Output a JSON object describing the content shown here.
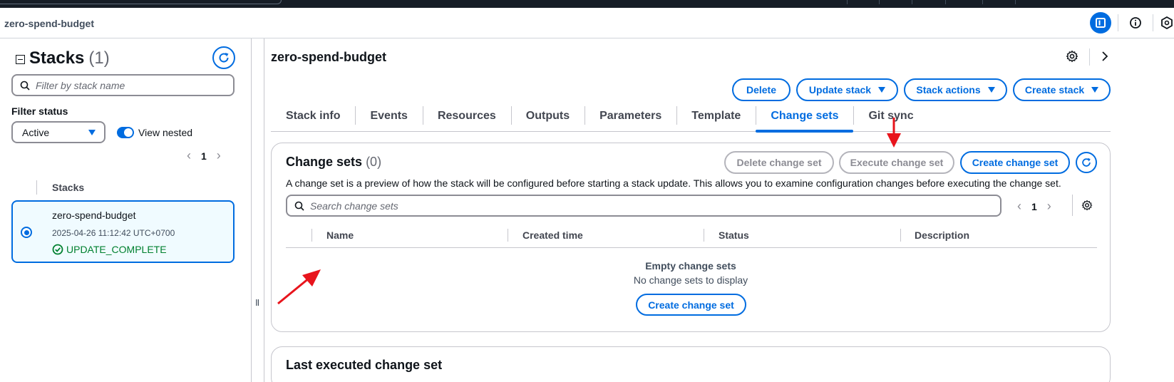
{
  "app": {
    "breadcrumb": "zero-spend-budget"
  },
  "colors": {
    "accent": "#006ce0",
    "success": "#00802f",
    "annotation_arrow": "#e8141c"
  },
  "topbar_icons": [
    "split-panel-icon",
    "info-icon",
    "settings-hex-icon"
  ],
  "sidebar": {
    "title": "Stacks",
    "count": "(1)",
    "search_placeholder": "Filter by stack name",
    "filter_status_label": "Filter status",
    "filter_status_value": "Active",
    "view_nested_label": "View nested",
    "page": "1",
    "column_header": "Stacks",
    "stacks": [
      {
        "name": "zero-spend-budget",
        "time": "2025-04-26 11:12:42 UTC+0700",
        "status": "UPDATE_COMPLETE",
        "selected": true
      }
    ],
    "resize_handle": "II"
  },
  "main": {
    "title": "zero-spend-budget",
    "actions": {
      "delete": "Delete",
      "update_stack": "Update stack",
      "stack_actions": "Stack actions",
      "create_stack": "Create stack"
    },
    "tabs": [
      {
        "label": "Stack info",
        "active": false
      },
      {
        "label": "Events",
        "active": false
      },
      {
        "label": "Resources",
        "active": false
      },
      {
        "label": "Outputs",
        "active": false
      },
      {
        "label": "Parameters",
        "active": false
      },
      {
        "label": "Template",
        "active": false
      },
      {
        "label": "Change sets",
        "active": true
      },
      {
        "label": "Git sync",
        "active": false
      }
    ]
  },
  "change_sets": {
    "title": "Change sets",
    "count": "(0)",
    "description": "A change set is a preview of how the stack will be configured before starting a stack update. This allows you to examine configuration changes before executing the change set.",
    "buttons": {
      "delete": "Delete change set",
      "execute": "Execute change set",
      "create": "Create change set"
    },
    "search_placeholder": "Search change sets",
    "page": "1",
    "columns": [
      "Name",
      "Created time",
      "Status",
      "Description"
    ],
    "empty_title": "Empty change sets",
    "empty_subtitle": "No change sets to display",
    "empty_create_button": "Create change set"
  },
  "last_executed": {
    "title": "Last executed change set"
  }
}
